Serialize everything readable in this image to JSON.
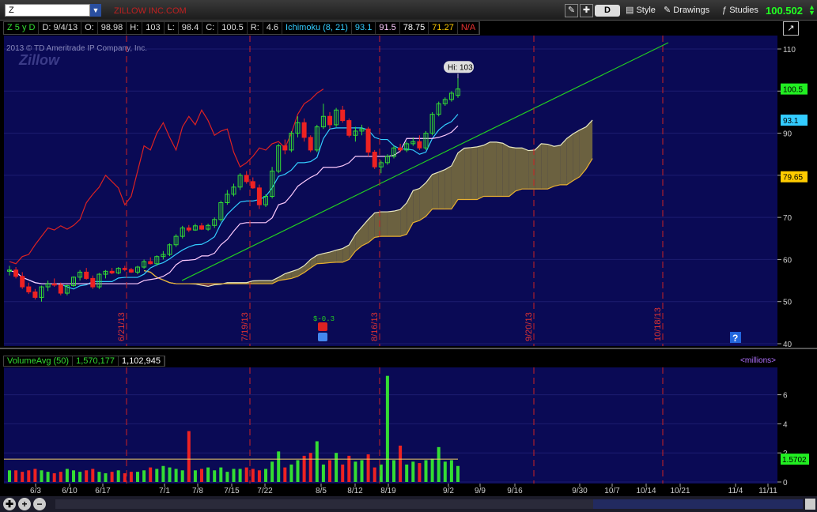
{
  "toolbar": {
    "symbol": "Z",
    "company_name": "ZILLOW INC.COM",
    "period": "D",
    "style_label": "Style",
    "drawings_label": "Drawings",
    "studies_label": "Studies",
    "last_price": "100.502"
  },
  "info_bar": {
    "aggregation": "Z 5 y D",
    "date": "D: 9/4/13",
    "open_label": "O:",
    "open": "98.98",
    "high_label": "H:",
    "high": "103",
    "low_label": "L:",
    "low": "98.4",
    "close_label": "C:",
    "close": "100.5",
    "range_label": "R:",
    "range": "4.6",
    "study": "Ichimoku (8, 21)",
    "v1": "93.1",
    "v2": "91.5",
    "v3": "78.75",
    "v4": "71.27",
    "v5": "N/A"
  },
  "watermark": "2013 © TD Ameritrade IP Company, Inc.",
  "logo": "Zillow",
  "volume_legend": {
    "study": "VolumeAvg (50)",
    "avg": "1,570,177",
    "vol": "1,102,945",
    "units": "<millions>"
  },
  "colors": {
    "background": "#0a0a55",
    "up": "#33dd33",
    "down": "#ee2222",
    "tenkan": "#33ccff",
    "kijun": "#ffccff",
    "chikou": "#dd2222",
    "trendline": "#22cc22",
    "cloud_bull": "#6b6140",
    "cloud_bear": "#5a1a3a"
  },
  "chart_data": {
    "type": "candlestick",
    "price_axis": {
      "min": 40,
      "max": 110,
      "ticks": [
        40,
        50,
        60,
        70,
        80,
        90,
        100,
        110
      ]
    },
    "high_label": "Hi: 103",
    "badges": [
      {
        "value": "100.5",
        "color": "#22ee22"
      },
      {
        "value": "93.1",
        "color": "#33ccff"
      },
      {
        "value": "79.65",
        "color": "#ffcc00"
      }
    ],
    "expiry_dates": [
      "6/21/13",
      "7/19/13",
      "8/16/13",
      "9/20/13",
      "10/18/13"
    ],
    "dividend_label": "$-0.3",
    "x_ticks": [
      "6/3",
      "6/10",
      "6/17",
      "7/1",
      "7/8",
      "7/15",
      "7/22",
      "8/5",
      "8/12",
      "8/19",
      "9/2",
      "9/9",
      "9/16",
      "9/30",
      "10/7",
      "10/14",
      "10/21",
      "11/4",
      "11/11"
    ],
    "candles": [
      [
        57.2,
        58.5,
        56.2,
        57.5
      ],
      [
        57.5,
        58.2,
        55.5,
        56.0
      ],
      [
        56.0,
        57.0,
        53.0,
        53.5
      ],
      [
        53.5,
        54.5,
        51.8,
        52.3
      ],
      [
        52.3,
        53.0,
        50.5,
        51.0
      ],
      [
        51.0,
        53.8,
        50.0,
        53.5
      ],
      [
        53.5,
        55.0,
        52.5,
        54.2
      ],
      [
        54.2,
        55.5,
        53.5,
        54.0
      ],
      [
        54.0,
        54.5,
        51.5,
        52.0
      ],
      [
        52.0,
        54.0,
        51.5,
        53.8
      ],
      [
        53.8,
        56.0,
        53.5,
        55.8
      ],
      [
        55.8,
        57.5,
        55.0,
        57.0
      ],
      [
        57.0,
        58.0,
        55.2,
        55.5
      ],
      [
        55.5,
        56.2,
        53.0,
        53.5
      ],
      [
        53.5,
        56.8,
        53.0,
        56.5
      ],
      [
        56.5,
        57.5,
        55.5,
        57.2
      ],
      [
        57.2,
        58.0,
        56.5,
        56.8
      ],
      [
        56.8,
        58.2,
        56.5,
        57.9
      ],
      [
        57.9,
        58.5,
        57.2,
        57.6
      ],
      [
        57.6,
        58.0,
        56.8,
        57.0
      ],
      [
        57.0,
        58.5,
        56.5,
        58.2
      ],
      [
        58.2,
        60.0,
        57.8,
        59.5
      ],
      [
        59.5,
        60.5,
        58.8,
        59.0
      ],
      [
        59.0,
        61.0,
        58.5,
        60.7
      ],
      [
        60.7,
        62.0,
        60.0,
        61.2
      ],
      [
        61.2,
        63.8,
        60.8,
        63.5
      ],
      [
        63.5,
        66.0,
        63.0,
        65.5
      ],
      [
        65.5,
        68.0,
        65.0,
        67.5
      ],
      [
        67.5,
        68.2,
        66.5,
        67.0
      ],
      [
        67.0,
        68.5,
        66.8,
        68.0
      ],
      [
        68.0,
        68.7,
        67.0,
        67.2
      ],
      [
        67.2,
        68.5,
        66.8,
        68.1
      ],
      [
        68.1,
        70.0,
        67.5,
        69.5
      ],
      [
        69.5,
        74.0,
        69.0,
        73.5
      ],
      [
        73.5,
        76.5,
        73.0,
        75.5
      ],
      [
        75.5,
        78.0,
        75.0,
        77.2
      ],
      [
        77.2,
        80.5,
        76.5,
        80.0
      ],
      [
        80.0,
        81.0,
        78.0,
        78.5
      ],
      [
        78.5,
        79.5,
        76.8,
        77.0
      ],
      [
        77.0,
        77.8,
        72.0,
        73.0
      ],
      [
        73.0,
        75.5,
        72.5,
        75.0
      ],
      [
        75.0,
        82.0,
        74.5,
        81.0
      ],
      [
        81.0,
        87.5,
        80.5,
        87.0
      ],
      [
        87.0,
        88.5,
        85.0,
        86.0
      ],
      [
        86.0,
        90.5,
        85.5,
        90.0
      ],
      [
        90.0,
        94.0,
        89.0,
        92.5
      ],
      [
        92.5,
        93.5,
        88.0,
        89.0
      ],
      [
        89.0,
        89.5,
        85.5,
        86.0
      ],
      [
        86.0,
        92.0,
        85.5,
        91.5
      ],
      [
        91.5,
        97.0,
        91.0,
        94.0
      ],
      [
        94.0,
        95.0,
        91.0,
        92.0
      ],
      [
        92.0,
        96.0,
        91.5,
        95.5
      ],
      [
        95.5,
        96.5,
        92.5,
        93.0
      ],
      [
        93.0,
        93.5,
        89.0,
        89.5
      ],
      [
        89.5,
        91.5,
        88.0,
        90.5
      ],
      [
        90.5,
        92.0,
        89.5,
        91.0
      ],
      [
        91.0,
        91.5,
        84.5,
        85.5
      ],
      [
        85.5,
        86.0,
        81.5,
        82.0
      ],
      [
        82.0,
        83.5,
        80.5,
        83.0
      ],
      [
        83.0,
        85.0,
        82.5,
        84.5
      ],
      [
        84.5,
        87.0,
        84.0,
        86.5
      ],
      [
        86.5,
        87.5,
        85.5,
        86.0
      ],
      [
        86.0,
        88.0,
        85.5,
        87.5
      ],
      [
        87.5,
        89.0,
        87.0,
        88.0
      ],
      [
        88.0,
        89.5,
        86.0,
        86.5
      ],
      [
        86.5,
        90.5,
        86.0,
        90.0
      ],
      [
        90.0,
        95.0,
        89.5,
        94.5
      ],
      [
        94.5,
        97.5,
        94.0,
        97.0
      ],
      [
        97.0,
        98.5,
        96.5,
        98.0
      ],
      [
        98.0,
        100.0,
        97.5,
        99.5
      ],
      [
        98.98,
        103.0,
        98.4,
        100.5
      ]
    ],
    "volume_axis": {
      "min": 0,
      "max": 7.5,
      "ticks": [
        0,
        2,
        4,
        6
      ],
      "highlight": "1.5702"
    },
    "volume": [
      0.8,
      0.8,
      0.7,
      0.8,
      0.9,
      0.8,
      0.7,
      0.6,
      0.7,
      0.9,
      0.8,
      0.7,
      0.8,
      0.9,
      0.7,
      0.6,
      0.7,
      0.8,
      0.6,
      0.7,
      0.7,
      0.8,
      1.0,
      0.9,
      1.1,
      1.0,
      0.9,
      0.8,
      3.5,
      0.8,
      0.9,
      1.0,
      0.8,
      1.0,
      0.7,
      0.9,
      0.9,
      1.0,
      0.9,
      0.8,
      0.9,
      1.4,
      2.1,
      1.0,
      1.2,
      1.5,
      1.8,
      2.0,
      2.8,
      1.2,
      1.5,
      2.0,
      1.2,
      1.8,
      1.4,
      1.5,
      1.9,
      1.0,
      1.2,
      7.3,
      1.5,
      2.5,
      1.2,
      1.4,
      1.3,
      1.5,
      1.6,
      2.4,
      1.4,
      1.5,
      1.1
    ],
    "volume_avg_level": 1.57
  }
}
